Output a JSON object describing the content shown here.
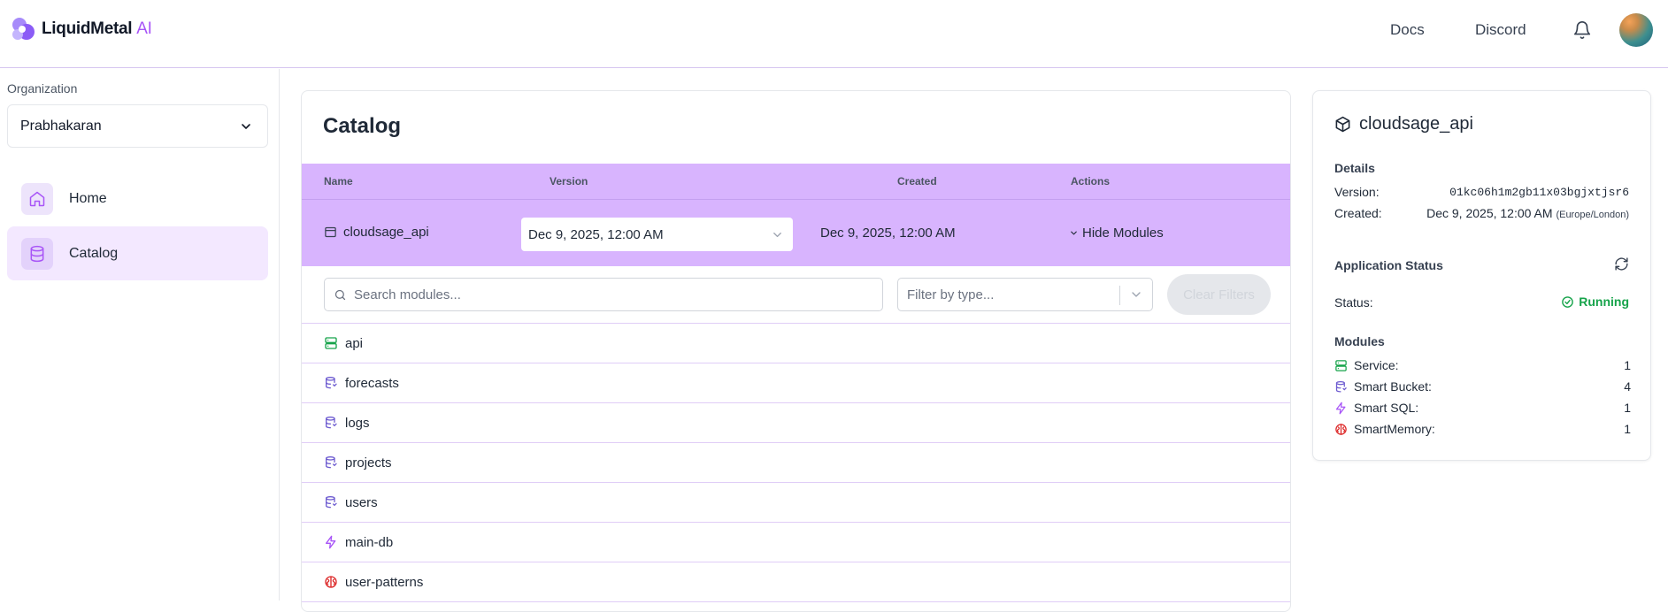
{
  "header": {
    "logo_text": "LiquidMetal",
    "logo_suffix": "AI",
    "nav": [
      "Docs",
      "Discord"
    ],
    "icons": {
      "notifications": "bell-icon",
      "profile": "avatar"
    }
  },
  "sidebar": {
    "org_label": "Organization",
    "org_value": "Prabhakaran",
    "items": [
      {
        "label": "Home",
        "icon": "home-icon",
        "active": false
      },
      {
        "label": "Catalog",
        "icon": "database-icon",
        "active": true
      }
    ]
  },
  "catalog": {
    "title": "Catalog",
    "columns": [
      "Name",
      "Version",
      "Created",
      "Actions"
    ],
    "app": {
      "name": "cloudsage_api",
      "version": "Dec 9, 2025, 12:00 AM",
      "created": "Dec 9, 2025, 12:00 AM",
      "action": "Hide Modules"
    },
    "filters": {
      "search_placeholder": "Search modules...",
      "type_placeholder": "Filter by type...",
      "clear_label": "Clear Filters"
    },
    "modules": [
      {
        "name": "api",
        "type": "service"
      },
      {
        "name": "forecasts",
        "type": "bucket"
      },
      {
        "name": "logs",
        "type": "bucket"
      },
      {
        "name": "projects",
        "type": "bucket"
      },
      {
        "name": "users",
        "type": "bucket"
      },
      {
        "name": "main-db",
        "type": "sql"
      },
      {
        "name": "user-patterns",
        "type": "memory"
      }
    ]
  },
  "details": {
    "title": "cloudsage_api",
    "details_label": "Details",
    "version_label": "Version:",
    "version_value": "01kc06h1m2gb11x03bgjxtjsr6",
    "created_label": "Created:",
    "created_value": "Dec 9, 2025, 12:00 AM",
    "created_tz": "(Europe/London)",
    "app_status_label": "Application Status",
    "status_label": "Status:",
    "status_value": "Running",
    "modules_label": "Modules",
    "module_counts": [
      {
        "label": "Service:",
        "count": "1",
        "type": "service"
      },
      {
        "label": "Smart Bucket:",
        "count": "4",
        "type": "bucket"
      },
      {
        "label": "Smart SQL:",
        "count": "1",
        "type": "sql"
      },
      {
        "label": "SmartMemory:",
        "count": "1",
        "type": "memory"
      }
    ]
  },
  "colors": {
    "accent": "#a855f7",
    "row_highlight": "#d8b4fe",
    "service": "#16a34a",
    "bucket": "#6d5bd0",
    "sql": "#a855f7",
    "memory": "#dc2626",
    "running": "#16a34a"
  }
}
